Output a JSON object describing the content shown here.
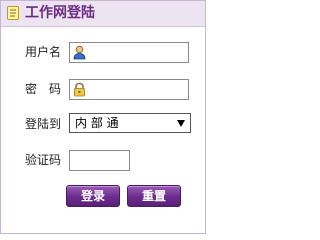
{
  "header": {
    "title": "工作网登陆",
    "icon": "note-icon"
  },
  "form": {
    "username_label": "用户名",
    "username_value": "",
    "username_icon": "user-icon",
    "password_label": "密　码",
    "password_value": "",
    "password_icon": "lock-icon",
    "login_to_label": "登陆到",
    "login_to_selected": "内 部 通",
    "captcha_label": "验证码",
    "captcha_value": ""
  },
  "buttons": {
    "login_label": "登录",
    "reset_label": "重置"
  },
  "colors": {
    "brand": "#6a2d82",
    "header_bg": "#ece4f1",
    "panel_border": "#c8b4d4",
    "button": "#6c2c8c"
  }
}
